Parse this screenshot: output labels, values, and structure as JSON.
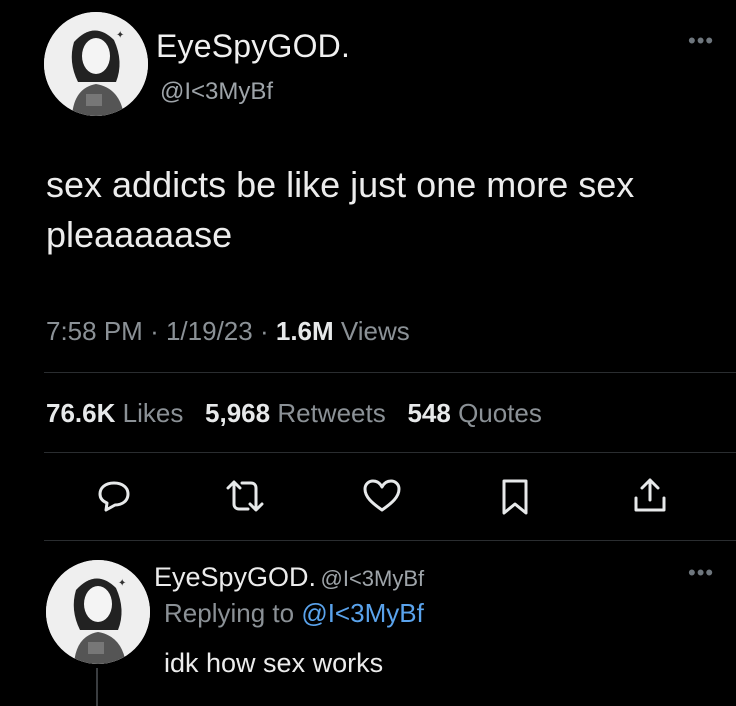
{
  "tweet": {
    "display_name": "EyeSpyGOD.",
    "handle": "@I<3MyBf",
    "more_icon": "more-horizontal-icon",
    "text_line1": "sex addicts be like just one more sex",
    "text_line2": "pleaaaaase",
    "time": "7:58 PM",
    "sep1": "·",
    "date": "1/19/23",
    "sep2": "·",
    "views_count": "1.6M",
    "views_label": "Views",
    "likes_count": "76.6K",
    "likes_label": "Likes",
    "retweets_count": "5,968",
    "retweets_label": "Retweets",
    "quotes_count": "548",
    "quotes_label": "Quotes"
  },
  "actions": [
    "reply-icon",
    "retweet-icon",
    "like-icon",
    "bookmark-icon",
    "share-icon"
  ],
  "reply": {
    "display_name": "EyeSpyGOD.",
    "handle": "@I<3MyBf",
    "replying_prefix": "Replying to",
    "replying_handle": "@I<3MyBf",
    "text": "idk how sex works"
  },
  "colors": {
    "background": "#000000",
    "text": "#e7e9ea",
    "muted": "#8b9196",
    "link": "#5aa3ec"
  }
}
